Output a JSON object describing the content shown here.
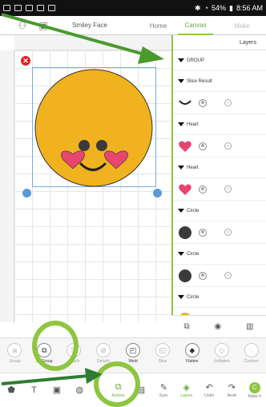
{
  "status": {
    "battery": "54%",
    "time": "8:56 AM"
  },
  "topbar": {
    "title": "Smiley Face",
    "tabs": [
      "Home",
      "Canvas",
      "Make"
    ]
  },
  "layers": {
    "heading": "Layers",
    "rows": [
      {
        "type": "head",
        "label": "GROUP"
      },
      {
        "type": "head",
        "label": "Slice Result"
      },
      {
        "type": "item",
        "thumb": "smile"
      },
      {
        "type": "head",
        "label": "Heart"
      },
      {
        "type": "item",
        "thumb": "heart"
      },
      {
        "type": "head",
        "label": "Heart"
      },
      {
        "type": "item",
        "thumb": "heart"
      },
      {
        "type": "head",
        "label": "Circle"
      },
      {
        "type": "item",
        "thumb": "dark-circle"
      },
      {
        "type": "head",
        "label": "Circle"
      },
      {
        "type": "item",
        "thumb": "dark-circle"
      },
      {
        "type": "head",
        "label": "Circle"
      },
      {
        "type": "item",
        "thumb": "yellow-circle"
      }
    ]
  },
  "tools": [
    "Group",
    "UnGroup",
    "Attach",
    "Detach",
    "Weld",
    "Slice",
    "Flatten",
    "Unflatten",
    "Contour"
  ],
  "bottom": [
    "",
    "",
    "",
    "",
    "Actions",
    "",
    "Sync",
    "Layers",
    "Undo",
    "Redo",
    "Make It"
  ],
  "colors": {
    "accent": "#8dc63f",
    "face": "#f0b21e",
    "heart": "#e8456f",
    "dark": "#3a3a3a"
  }
}
